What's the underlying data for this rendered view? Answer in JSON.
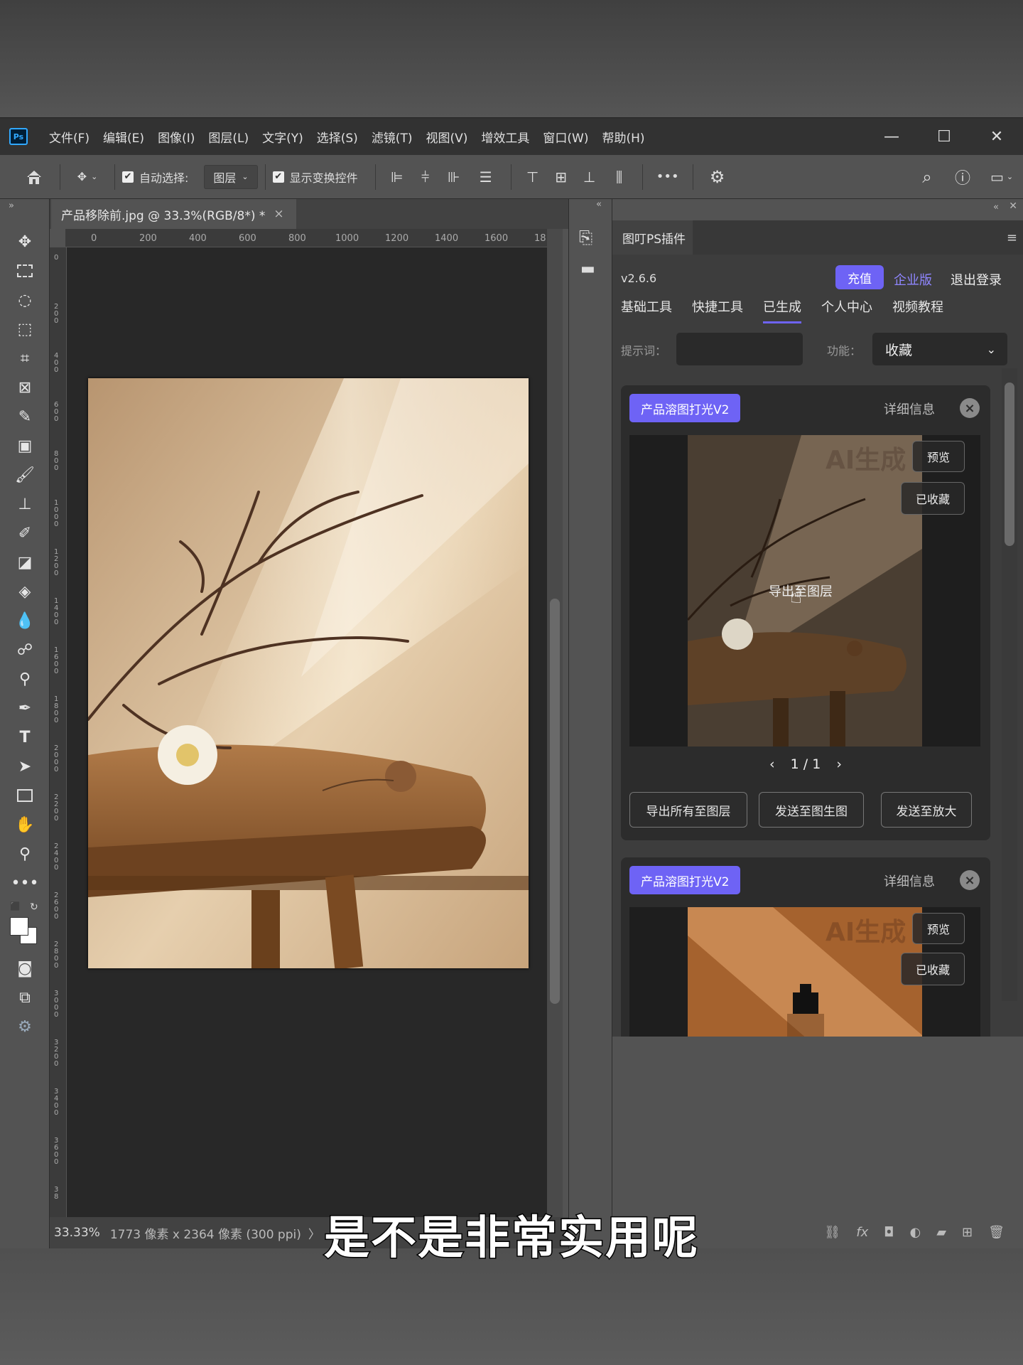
{
  "app": {
    "logo": "Ps"
  },
  "menu": [
    "文件(F)",
    "编辑(E)",
    "图像(I)",
    "图层(L)",
    "文字(Y)",
    "选择(S)",
    "滤镜(T)",
    "视图(V)",
    "增效工具",
    "窗口(W)",
    "帮助(H)"
  ],
  "window_controls": {
    "minimize": "—",
    "maximize": "☐",
    "close": "✕"
  },
  "options": {
    "auto_select_label": "自动选择:",
    "auto_select_value": "图层",
    "show_transform_label": "显示变换控件",
    "more": "•••"
  },
  "document": {
    "tab_title": "产品移除前.jpg @ 33.3%(RGB/8*) *",
    "close": "×"
  },
  "ruler_h": [
    "0",
    "200",
    "400",
    "600",
    "800",
    "1000",
    "1200",
    "1400",
    "1600",
    "18"
  ],
  "ruler_v": [
    "0",
    "2 0 0",
    "4 0 0",
    "6 0 0",
    "8 0 0",
    "1 0 0 0",
    "1 2 0 0",
    "1 4 0 0",
    "1 6 0 0",
    "1 8 0 0",
    "2 0 0 0",
    "2 2 0 0",
    "2 4 0 0",
    "2 6 0 0",
    "2 8 0 0",
    "3 0 0 0",
    "3 2 0 0",
    "3 4 0 0",
    "3 6 0 0",
    "3 8"
  ],
  "status": {
    "zoom": "33.33%",
    "info": "1773 像素 x 2364 像素 (300 ppi)",
    "arrow": "〉"
  },
  "plugin": {
    "panel_tab": "图叮PS插件",
    "version": "v2.6.6",
    "recharge": "充值",
    "enterprise": "企业版",
    "logout": "退出登录",
    "nav": [
      "基础工具",
      "快捷工具",
      "已生成",
      "个人中心",
      "视频教程"
    ],
    "prompt_label": "提示词：",
    "function_label": "功能：",
    "function_value": "收藏",
    "cards": [
      {
        "badge": "产品溶图打光V2",
        "detail": "详细信息",
        "watermark": "AI生成",
        "preview": "预览",
        "favorited": "已收藏",
        "export_layer": "导出至图层",
        "pager": "1 / 1",
        "btn_export_all": "导出所有至图层",
        "btn_send_img": "发送至图生图",
        "btn_send_upscale": "发送至放大"
      },
      {
        "badge": "产品溶图打光V2",
        "detail": "详细信息",
        "watermark": "AI生成",
        "preview": "预览",
        "favorited": "已收藏"
      }
    ]
  },
  "subtitle": "是不是非常实用呢"
}
